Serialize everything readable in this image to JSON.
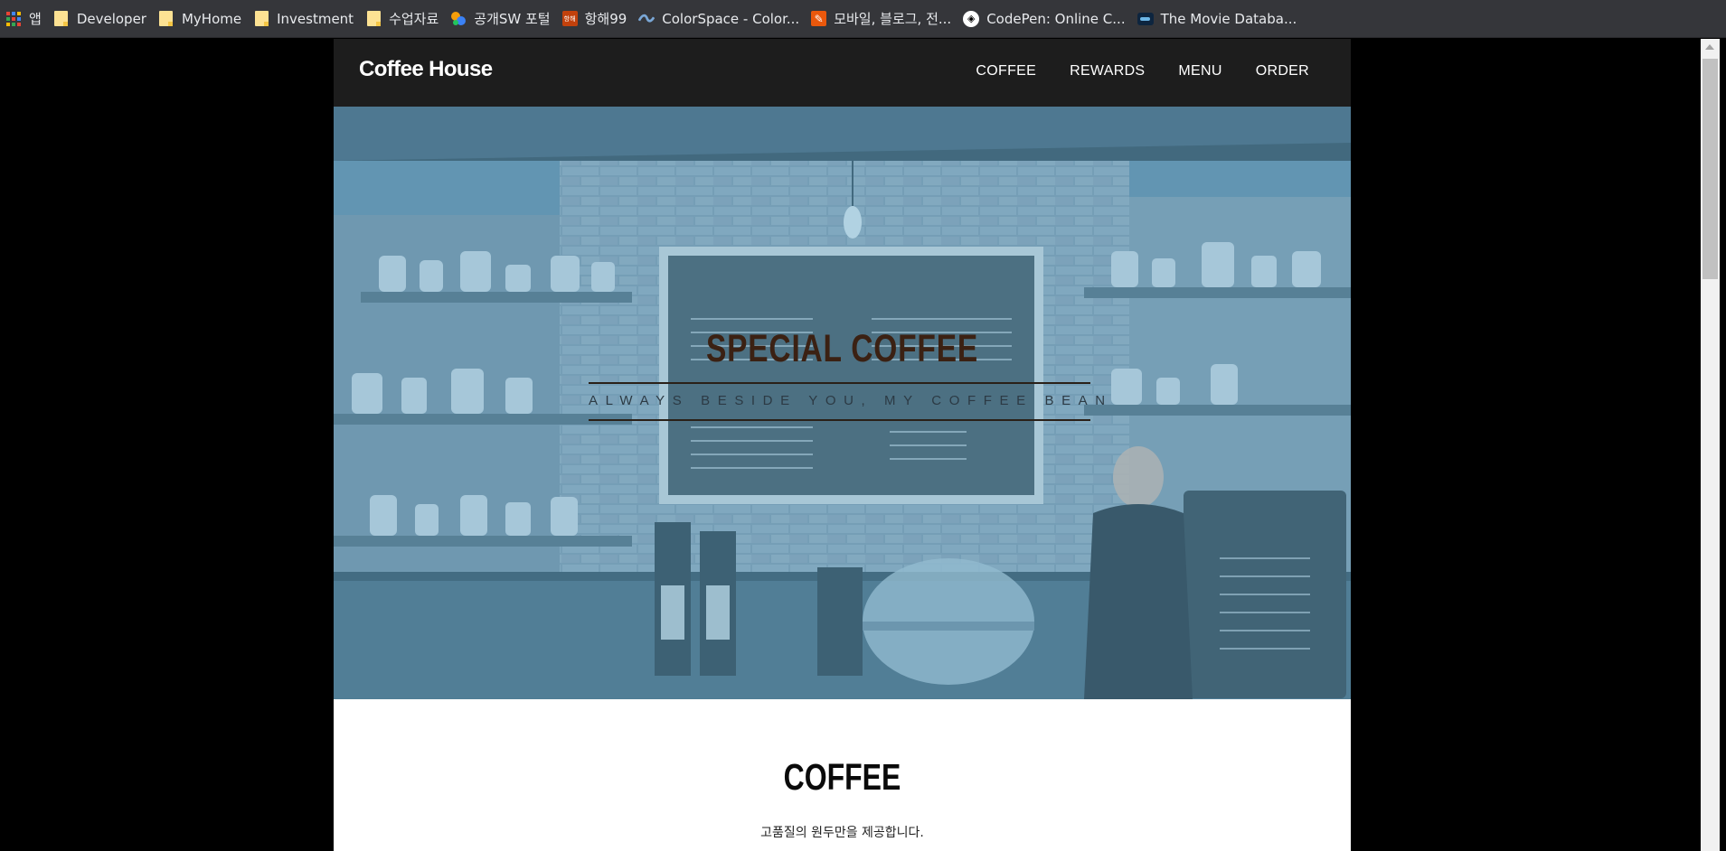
{
  "bookmarks": [
    {
      "label": "앱",
      "icon": "apps-icon"
    },
    {
      "label": "Developer",
      "icon": "folder-icon"
    },
    {
      "label": "MyHome",
      "icon": "folder-icon"
    },
    {
      "label": "Investment",
      "icon": "folder-icon"
    },
    {
      "label": "수업자료",
      "icon": "folder-icon"
    },
    {
      "label": "공개SW 포털",
      "icon": "oss-portal-icon"
    },
    {
      "label": "항해99",
      "icon": "hanghae-icon",
      "icon_text": "항해"
    },
    {
      "label": "ColorSpace - Color...",
      "icon": "colorspace-icon"
    },
    {
      "label": "모바일, 블로그, 전...",
      "icon": "pencil-icon"
    },
    {
      "label": "CodePen: Online C...",
      "icon": "codepen-icon"
    },
    {
      "label": "The Movie Databa...",
      "icon": "tmdb-icon"
    }
  ],
  "nav": {
    "brand": "Coffee House",
    "links": [
      "COFFEE",
      "REWARDS",
      "MENU",
      "ORDER"
    ]
  },
  "hero": {
    "title": "SPECIAL COFFEE",
    "subtitle": "ALWAYS BESIDE YOU, MY COFFEE BEAN",
    "overlay_color": "#6aa9c9"
  },
  "section": {
    "title": "COFFEE",
    "description": "고품질의 원두만을 제공합니다."
  },
  "colors": {
    "nav_bg": "#1d1d1d",
    "bookmarks_bg": "#35363a",
    "hero_title": "#3b2113"
  }
}
